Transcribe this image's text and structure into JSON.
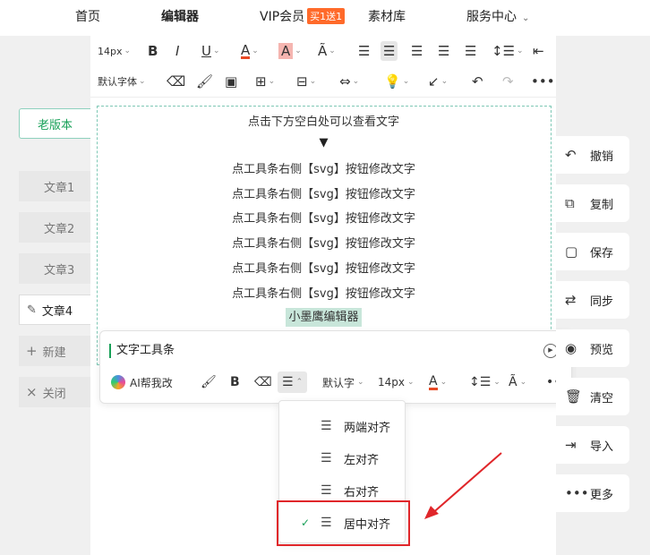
{
  "nav": {
    "home": "首页",
    "editor": "编辑器",
    "vip": "VIP会员",
    "vip_badge": "买1送1",
    "materials": "素材库",
    "service": "服务中心"
  },
  "toolbar": {
    "font_size": "14px",
    "font_family": "默认字体"
  },
  "content": {
    "hint": "点击下方空白处可以查看文字",
    "arrow": "▼",
    "lines": [
      "点工具条右侧【svg】按钮修改文字",
      "点工具条右侧【svg】按钮修改文字",
      "点工具条右侧【svg】按钮修改文字",
      "点工具条右侧【svg】按钮修改文字",
      "点工具条右侧【svg】按钮修改文字",
      "点工具条右侧【svg】按钮修改文字"
    ],
    "brand": "小墨鹰编辑器"
  },
  "text_toolbar": {
    "title": "文字工具条",
    "ai": "AI帮我改",
    "font_family": "默认字",
    "font_size": "14px"
  },
  "align_menu": {
    "items": [
      {
        "label": "两端对齐",
        "checked": false
      },
      {
        "label": "左对齐",
        "checked": false
      },
      {
        "label": "右对齐",
        "checked": false
      },
      {
        "label": "居中对齐",
        "checked": true
      }
    ]
  },
  "sidebar": {
    "old_version": "老版本",
    "articles": [
      "文章1",
      "文章2",
      "文章3",
      "文章4"
    ],
    "new": "新建",
    "close": "关闭"
  },
  "right_panel": {
    "undo": "撤销",
    "copy": "复制",
    "save": "保存",
    "sync": "同步",
    "preview": "预览",
    "clear": "清空",
    "import": "导入",
    "more": "更多"
  },
  "colors": {
    "accent": "#18a058",
    "highlight_red": "#e0262a",
    "vip_badge": "#ff6a2a"
  }
}
